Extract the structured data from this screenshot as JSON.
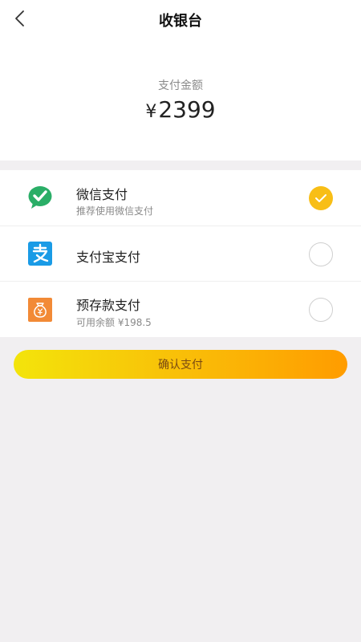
{
  "header": {
    "title": "收银台",
    "amount_label": "支付金额",
    "currency": "¥",
    "amount": "2399"
  },
  "methods": [
    {
      "name": "微信支付",
      "sub": "推荐使用微信支付",
      "icon": "wechat-pay-icon",
      "selected": true,
      "color": "#2aae67"
    },
    {
      "name": "支付宝支付",
      "icon": "alipay-icon",
      "selected": false,
      "color": "#1a9be6"
    },
    {
      "name": "预存款支付",
      "sub": "可用余额 ¥198.5",
      "icon": "wallet-icon",
      "selected": false,
      "color": "#f28a36"
    }
  ],
  "confirm": {
    "label": "确认支付"
  },
  "colors": {
    "accent": "#f8be16",
    "button_start": "#f3e40b",
    "button_end": "#ff9c00"
  }
}
